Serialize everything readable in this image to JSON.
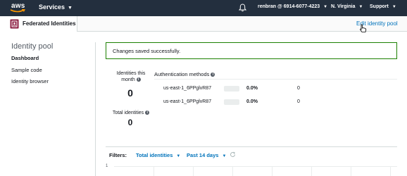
{
  "topbar": {
    "logo_text": "aws",
    "services_label": "Services",
    "account_label": "renbran @ 6914-6077-4223",
    "region_label": "N. Virginia",
    "support_label": "Support"
  },
  "service_header": {
    "title": "Federated Identities",
    "edit_link": "Edit identity pool"
  },
  "sidebar": {
    "title": "Identity pool",
    "items": [
      {
        "label": "Dashboard",
        "active": true
      },
      {
        "label": "Sample code",
        "active": false
      },
      {
        "label": "Identity browser",
        "active": false
      }
    ]
  },
  "banner": {
    "message": "Changes saved successfully."
  },
  "stats": {
    "identities_month_label_1": "Identities this",
    "identities_month_label_2": "month",
    "identities_month_value": "0",
    "total_identities_label": "Total identities",
    "total_identities_value": "0"
  },
  "auth_methods": {
    "title": "Authentication methods",
    "rows": [
      {
        "pool": "us-east-1_6PPglvR87",
        "percent": "0.0%",
        "count": "0"
      },
      {
        "pool": "us-east-1_6PPglvR87",
        "percent": "0.0%",
        "count": "0"
      }
    ]
  },
  "filters": {
    "label": "Filters:",
    "metric": "Total identities",
    "range": "Past 14 days"
  },
  "chart": {
    "y_tick": "1"
  },
  "colors": {
    "topbar_bg": "#232f3e",
    "link": "#0073bb",
    "success_border": "#1d8102"
  }
}
